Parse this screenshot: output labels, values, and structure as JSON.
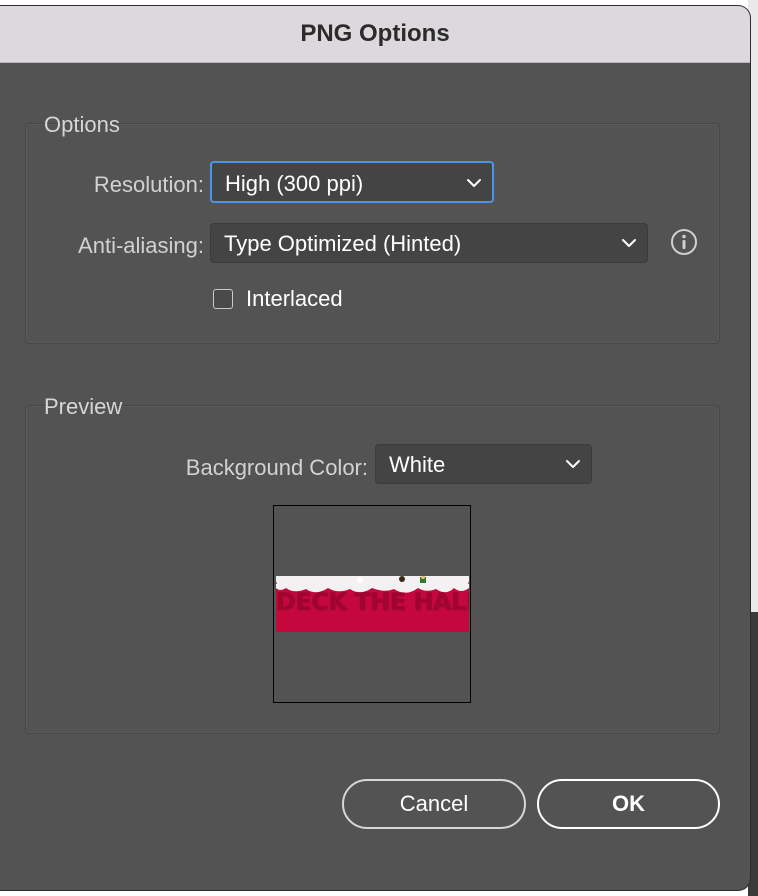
{
  "dialog": {
    "title": "PNG Options"
  },
  "options_group": {
    "label": "Options",
    "resolution": {
      "label": "Resolution:",
      "value": "High (300 ppi)"
    },
    "anti_aliasing": {
      "label": "Anti-aliasing:",
      "value": "Type Optimized (Hinted)"
    },
    "interlaced": {
      "label": "Interlaced",
      "checked": false
    }
  },
  "preview_group": {
    "label": "Preview",
    "background_color": {
      "label": "Background Color:",
      "value": "White"
    },
    "thumbnail": {
      "banner_text": "DECK THE HALLS"
    }
  },
  "buttons": {
    "cancel": "Cancel",
    "ok": "OK"
  },
  "icons": {
    "resolution_dropdown": "chevron-down-icon",
    "anti_aliasing_dropdown": "chevron-down-icon",
    "background_dropdown": "chevron-down-icon",
    "info": "info-icon"
  },
  "colors": {
    "dialog_bg": "#535353",
    "titlebar_bg": "#dcd8dc",
    "focus_ring": "#4b96ea",
    "banner_red": "#c4083d"
  }
}
